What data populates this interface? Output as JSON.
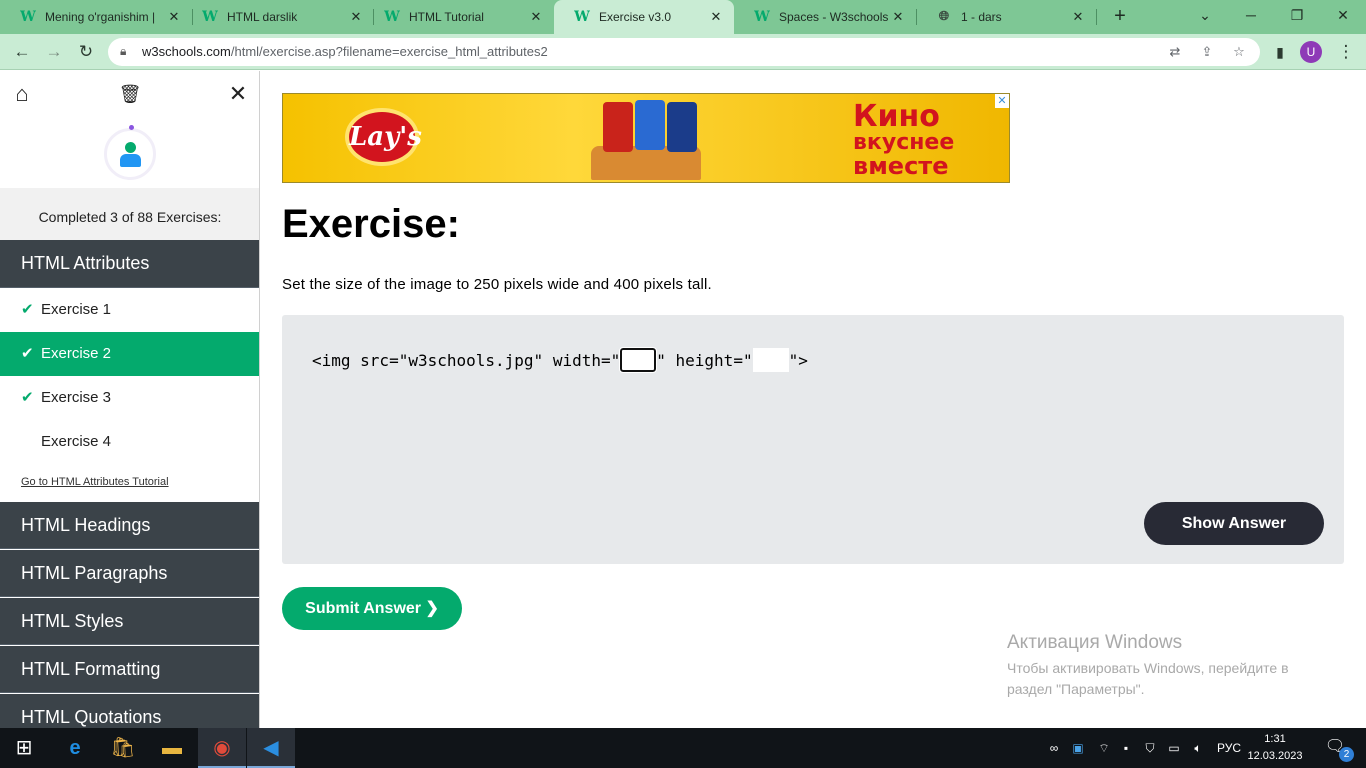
{
  "browser": {
    "tabs": [
      {
        "title": "Mening o'rganishim |",
        "favicon": "w3schools-icon"
      },
      {
        "title": "HTML darslik",
        "favicon": "w3schools-icon"
      },
      {
        "title": "HTML Tutorial",
        "favicon": "w3schools-icon"
      },
      {
        "title": "Exercise v3.0",
        "favicon": "w3schools-icon",
        "active": true
      },
      {
        "title": "Spaces - W3schools",
        "favicon": "w3schools-icon"
      },
      {
        "title": "1 - dars",
        "favicon": "globe-icon"
      }
    ],
    "tab_close_glyph": "✕",
    "new_tab_glyph": "+",
    "url_host": "w3schools.com",
    "url_path": "/html/exercise.asp?filename=exercise_html_attributes2",
    "profile_initial": "U",
    "colors": {
      "tabstrip": "#7ec795",
      "toolbar": "#c9ecd4"
    }
  },
  "sidebar": {
    "progress_text": "Completed 3 of 88 Exercises:",
    "active_category": "HTML Attributes",
    "exercises": [
      {
        "label": "Exercise 1",
        "completed": true
      },
      {
        "label": "Exercise 2",
        "completed": true,
        "active": true
      },
      {
        "label": "Exercise 3",
        "completed": true
      },
      {
        "label": "Exercise 4",
        "completed": false
      }
    ],
    "tutorial_link": "Go to HTML Attributes Tutorial",
    "categories": [
      "HTML Headings",
      "HTML Paragraphs",
      "HTML Styles",
      "HTML Formatting",
      "HTML Quotations"
    ],
    "colors": {
      "category_bg": "#3b4349",
      "active_exercise": "#04aa6d"
    }
  },
  "ad": {
    "brand": "Lay's",
    "headline": [
      "Кино",
      "вкуснее",
      "вместе"
    ]
  },
  "main": {
    "heading": "Exercise:",
    "instruction": "Set the size of the image to 250 pixels wide and 400 pixels tall.",
    "code": {
      "prefix": "<img src=\"w3schools.jpg\" width=\"",
      "middle": "\" height=\"",
      "suffix": "\">",
      "width_value": "",
      "height_value": ""
    },
    "show_answer_label": "Show Answer",
    "submit_label": "Submit Answer ❯",
    "colors": {
      "accent": "#04aa6d",
      "dark_button": "#282a35"
    }
  },
  "windows_watermark": {
    "title": "Активация Windows",
    "line1": "Чтобы активировать Windows, перейдите в",
    "line2": "раздел \"Параметры\"."
  },
  "taskbar": {
    "language": "РУС",
    "time": "1:31",
    "date": "12.03.2023",
    "notification_count": "2"
  }
}
